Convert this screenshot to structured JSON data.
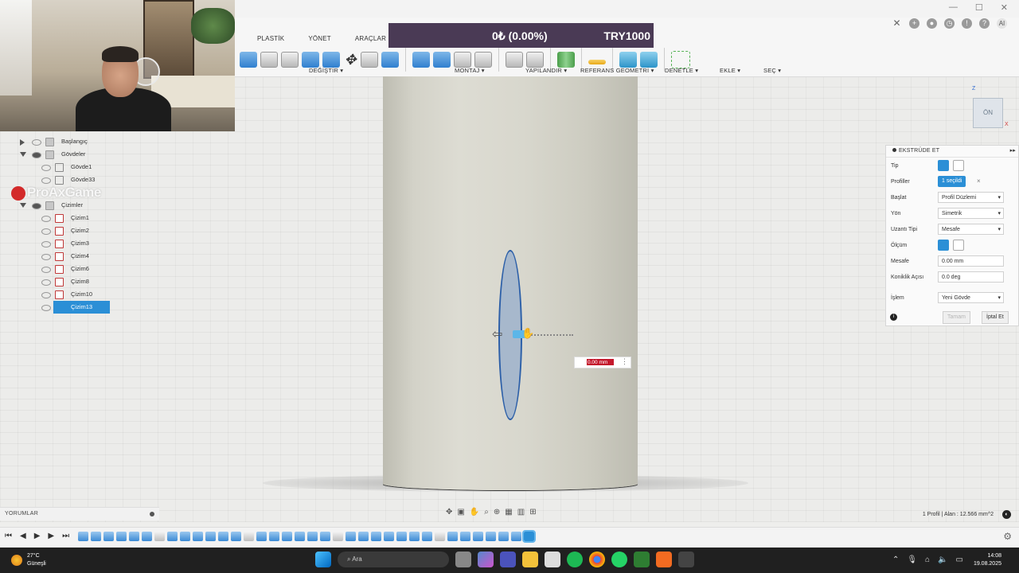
{
  "toolbar": {
    "tabs": [
      "PLASTİK",
      "YÖNET",
      "ARAÇLAR"
    ],
    "groups": {
      "degistir": "DEĞİŞTİR ▾",
      "montaj": "MONTAJ ▾",
      "yapilandir": "YAPILANDIR ▾",
      "referans": "REFERANS GEOMETRİ ▾",
      "denetle": "DENETLE ▾",
      "ekle": "EKLE ▾",
      "sec": "SEÇ ▾"
    }
  },
  "banner": {
    "value": "0₺ (0.00%)",
    "currency": "TRY1000"
  },
  "browser": {
    "items": [
      {
        "label": "Başlangıç",
        "type": "folder",
        "level": 0
      },
      {
        "label": "Gövdeler",
        "type": "folder",
        "level": 0
      },
      {
        "label": "Gövde1",
        "type": "body",
        "level": 1
      },
      {
        "label": "Gövde33",
        "type": "body",
        "level": 1
      },
      {
        "label": "Çizimler",
        "type": "folder",
        "level": 0
      },
      {
        "label": "Çizim1",
        "type": "sketch",
        "level": 1
      },
      {
        "label": "Çizim2",
        "type": "sketch",
        "level": 1
      },
      {
        "label": "Çizim3",
        "type": "sketch",
        "level": 1
      },
      {
        "label": "Çizim4",
        "type": "sketch",
        "level": 1
      },
      {
        "label": "Çizim6",
        "type": "sketch",
        "level": 1
      },
      {
        "label": "Çizim8",
        "type": "sketch",
        "level": 1
      },
      {
        "label": "Çizim10",
        "type": "sketch",
        "level": 1
      },
      {
        "label": "Çizim13",
        "type": "sketch",
        "level": 1,
        "selected": true
      }
    ]
  },
  "watermark": "ProAxGame",
  "viewport": {
    "dimension_value": "0.00 mm"
  },
  "viewcube": {
    "face": "ÖN",
    "z": "Z",
    "x": "X"
  },
  "panel": {
    "title": "EKSTRÜDE ET",
    "tip_label": "Tip",
    "profiller_label": "Profiller",
    "profiller_value": "1 seçildi",
    "baslat_label": "Başlat",
    "baslat_value": "Profil Düzlemi",
    "yon_label": "Yön",
    "yon_value": "Simetrik",
    "uzanti_label": "Uzantı Tipi",
    "uzanti_value": "Mesafe",
    "olcum_label": "Ölçüm",
    "mesafe_label": "Mesafe",
    "mesafe_value": "0.00 mm",
    "konik_label": "Koniklik Açısı",
    "konik_value": "0.0 deg",
    "islem_label": "İşlem",
    "islem_value": "Yeni Gövde",
    "tamam": "Tamam",
    "iptal": "İptal Et"
  },
  "comments": "YORUMLAR",
  "status": "1 Profil | Alan : 12.566 mm^2",
  "taskbar": {
    "temp": "27°C",
    "weather": "Güneşli",
    "search": "Ara",
    "time": "14:08",
    "date": "19.08.2025"
  }
}
